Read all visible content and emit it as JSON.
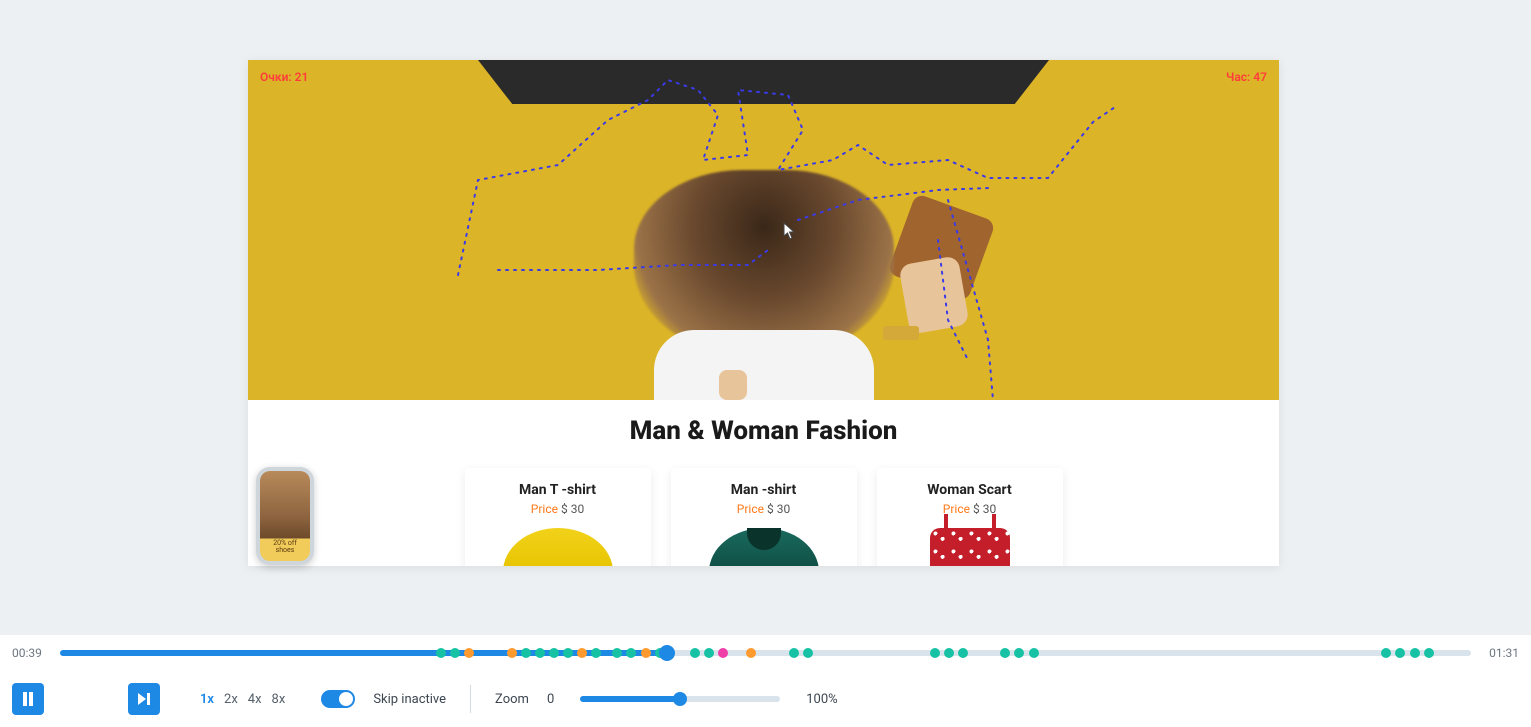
{
  "overlay": {
    "left_tag": "Очки: 21",
    "right_tag": "Час: 47"
  },
  "page": {
    "section_title": "Man & Woman Fashion",
    "products": [
      {
        "name": "Man T -shirt",
        "price_label": "Price",
        "price_value": "$ 30"
      },
      {
        "name": "Man -shirt",
        "price_label": "Price",
        "price_value": "$ 30"
      },
      {
        "name": "Woman Scart",
        "price_label": "Price",
        "price_value": "$ 30"
      }
    ]
  },
  "thumb": {
    "line1": "20% off",
    "line2": "shoes"
  },
  "player": {
    "time_current": "00:39",
    "time_total": "01:31",
    "progress_pct": 43,
    "speeds": [
      "1x",
      "2x",
      "4x",
      "8x"
    ],
    "speed_active": "1x",
    "skip_inactive_label": "Skip inactive",
    "zoom_label": "Zoom",
    "zoom_min": "0",
    "zoom_max": "100%",
    "events": [
      {
        "pos": 27,
        "c": "teal"
      },
      {
        "pos": 28,
        "c": "teal"
      },
      {
        "pos": 29,
        "c": "orange"
      },
      {
        "pos": 32,
        "c": "orange"
      },
      {
        "pos": 33,
        "c": "teal"
      },
      {
        "pos": 34,
        "c": "teal"
      },
      {
        "pos": 35,
        "c": "teal"
      },
      {
        "pos": 36,
        "c": "teal"
      },
      {
        "pos": 37,
        "c": "orange"
      },
      {
        "pos": 38,
        "c": "teal"
      },
      {
        "pos": 39.5,
        "c": "teal"
      },
      {
        "pos": 40.5,
        "c": "teal"
      },
      {
        "pos": 41.5,
        "c": "orange"
      },
      {
        "pos": 42.5,
        "c": "teal"
      },
      {
        "pos": 45,
        "c": "teal"
      },
      {
        "pos": 46,
        "c": "teal"
      },
      {
        "pos": 47,
        "c": "pink"
      },
      {
        "pos": 49,
        "c": "orange"
      },
      {
        "pos": 52,
        "c": "teal"
      },
      {
        "pos": 53,
        "c": "teal"
      },
      {
        "pos": 62,
        "c": "teal"
      },
      {
        "pos": 63,
        "c": "teal"
      },
      {
        "pos": 64,
        "c": "teal"
      },
      {
        "pos": 67,
        "c": "teal"
      },
      {
        "pos": 68,
        "c": "teal"
      },
      {
        "pos": 69,
        "c": "teal"
      },
      {
        "pos": 94,
        "c": "teal"
      },
      {
        "pos": 95,
        "c": "teal"
      },
      {
        "pos": 96,
        "c": "teal"
      },
      {
        "pos": 97,
        "c": "teal"
      }
    ]
  }
}
